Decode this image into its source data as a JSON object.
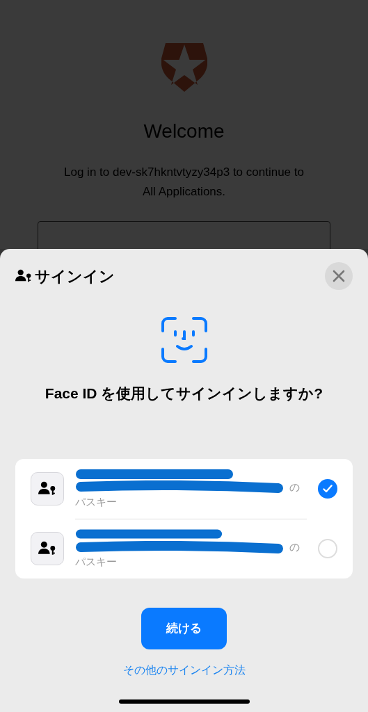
{
  "backdrop": {
    "heading": "Welcome",
    "message_lines": [
      "Log in to dev-sk7hkntvtyzy34p3 to continue to",
      "All Applications."
    ]
  },
  "sheet": {
    "title": "サインイン",
    "question": "Face ID を使用してサインインしますか?",
    "passkeys": [
      {
        "suffix": "の",
        "label": "パスキー",
        "selected": true
      },
      {
        "suffix": "の",
        "label": "パスキー",
        "selected": false
      }
    ],
    "continue_button": "続ける",
    "other_link": "その他のサインイン方法"
  }
}
